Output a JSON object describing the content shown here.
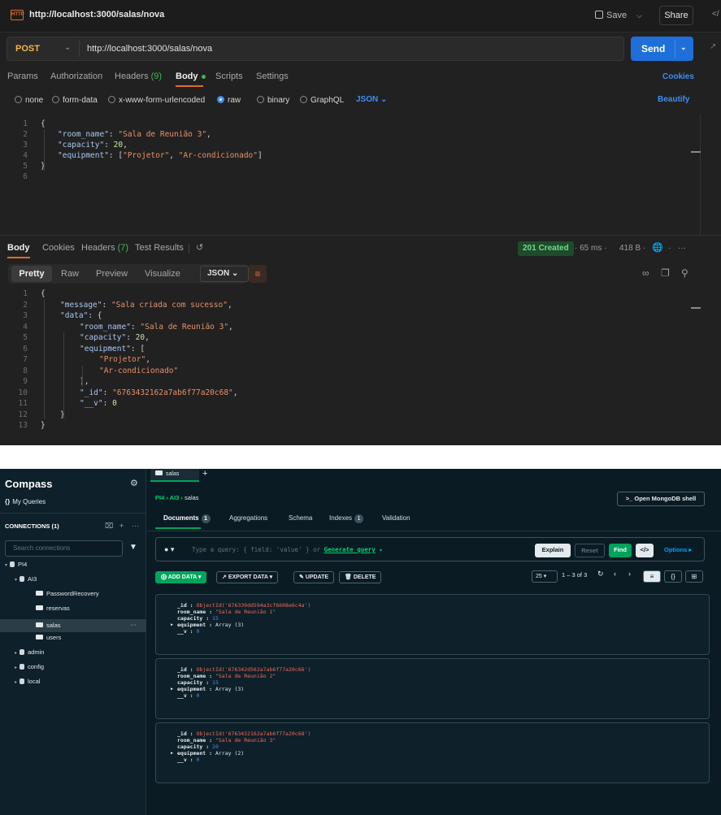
{
  "postman": {
    "window_title": "http://localhost:3000/salas/nova",
    "save_label": "Save",
    "share_label": "Share",
    "method": "POST",
    "url": "http://localhost:3000/salas/nova",
    "send_label": "Send",
    "req_tabs": {
      "params": "Params",
      "authorization": "Authorization",
      "headers": "Headers",
      "headers_count": "(9)",
      "body": "Body",
      "scripts": "Scripts",
      "settings": "Settings"
    },
    "cookies_label": "Cookies",
    "body_types": [
      "none",
      "form-data",
      "x-www-form-urlencoded",
      "raw",
      "binary",
      "GraphQL"
    ],
    "raw_format": "JSON",
    "beautify_label": "Beautify",
    "request_lines": [
      {
        "n": "1",
        "indent": 0,
        "parts": [
          [
            "p",
            "{"
          ]
        ]
      },
      {
        "n": "2",
        "indent": 1,
        "parts": [
          [
            "k",
            "\"room_name\""
          ],
          [
            "p",
            ": "
          ],
          [
            "s",
            "\"Sala de Reunião 3\""
          ],
          [
            "p",
            ","
          ]
        ]
      },
      {
        "n": "3",
        "indent": 1,
        "parts": [
          [
            "k",
            "\"capacity\""
          ],
          [
            "p",
            ": "
          ],
          [
            "n",
            "20"
          ],
          [
            "p",
            ","
          ]
        ]
      },
      {
        "n": "4",
        "indent": 1,
        "parts": [
          [
            "k",
            "\"equipment\""
          ],
          [
            "p",
            ": ["
          ],
          [
            "s",
            "\"Projetor\""
          ],
          [
            "p",
            ", "
          ],
          [
            "s",
            "\"Ar-condicionado\""
          ],
          [
            "p",
            "]"
          ]
        ]
      },
      {
        "n": "5",
        "indent": 0,
        "parts": [
          [
            "p",
            "}"
          ]
        ]
      },
      {
        "n": "6",
        "indent": 0,
        "parts": []
      }
    ],
    "resp_tabs": {
      "body": "Body",
      "cookies": "Cookies",
      "headers": "Headers",
      "headers_count": "(7)",
      "test_results": "Test Results"
    },
    "status": "201 Created",
    "time": "65 ms",
    "size": "418 B",
    "resp_formats": [
      "Pretty",
      "Raw",
      "Preview",
      "Visualize"
    ],
    "resp_format_sel": "JSON",
    "response_lines": [
      {
        "n": "1",
        "indent": 0,
        "parts": [
          [
            "p",
            "{"
          ]
        ]
      },
      {
        "n": "2",
        "indent": 1,
        "parts": [
          [
            "k",
            "\"message\""
          ],
          [
            "p",
            ": "
          ],
          [
            "s",
            "\"Sala criada com sucesso\""
          ],
          [
            "p",
            ","
          ]
        ]
      },
      {
        "n": "3",
        "indent": 1,
        "parts": [
          [
            "k",
            "\"data\""
          ],
          [
            "p",
            ": {"
          ]
        ]
      },
      {
        "n": "4",
        "indent": 2,
        "parts": [
          [
            "k",
            "\"room_name\""
          ],
          [
            "p",
            ": "
          ],
          [
            "s",
            "\"Sala de Reunião 3\""
          ],
          [
            "p",
            ","
          ]
        ]
      },
      {
        "n": "5",
        "indent": 2,
        "parts": [
          [
            "k",
            "\"capacity\""
          ],
          [
            "p",
            ": "
          ],
          [
            "n",
            "20"
          ],
          [
            "p",
            ","
          ]
        ]
      },
      {
        "n": "6",
        "indent": 2,
        "parts": [
          [
            "k",
            "\"equipment\""
          ],
          [
            "p",
            ": ["
          ]
        ]
      },
      {
        "n": "7",
        "indent": 3,
        "parts": [
          [
            "s",
            "\"Projetor\""
          ],
          [
            "p",
            ","
          ]
        ]
      },
      {
        "n": "8",
        "indent": 3,
        "parts": [
          [
            "s",
            "\"Ar-condicionado\""
          ]
        ]
      },
      {
        "n": "9",
        "indent": 2,
        "parts": [
          [
            "p",
            "],"
          ]
        ]
      },
      {
        "n": "10",
        "indent": 2,
        "parts": [
          [
            "k",
            "\"_id\""
          ],
          [
            "p",
            ": "
          ],
          [
            "s",
            "\"6763432162a7ab6f77a20c68\""
          ],
          [
            "p",
            ","
          ]
        ]
      },
      {
        "n": "11",
        "indent": 2,
        "parts": [
          [
            "k",
            "\"__v\""
          ],
          [
            "p",
            ": "
          ],
          [
            "n",
            "0"
          ]
        ]
      },
      {
        "n": "12",
        "indent": 1,
        "parts": [
          [
            "p",
            "}"
          ]
        ]
      },
      {
        "n": "13",
        "indent": 0,
        "parts": [
          [
            "p",
            "}"
          ]
        ]
      }
    ]
  },
  "compass": {
    "brand": "Compass",
    "my_queries": "My Queries",
    "connections_label": "CONNECTIONS (1)",
    "search_placeholder": "Search connections",
    "tree": [
      {
        "level": 0,
        "type": "conn",
        "label": "PI4"
      },
      {
        "level": 1,
        "type": "db",
        "label": "AI3"
      },
      {
        "level": 2,
        "type": "col",
        "label": "PasswordRecovery"
      },
      {
        "level": 2,
        "type": "col",
        "label": "reservas"
      },
      {
        "level": 2,
        "type": "col",
        "label": "salas",
        "selected": true
      },
      {
        "level": 2,
        "type": "col",
        "label": "users"
      },
      {
        "level": 1,
        "type": "db",
        "label": "admin"
      },
      {
        "level": 1,
        "type": "db",
        "label": "config"
      },
      {
        "level": 1,
        "type": "db",
        "label": "local"
      }
    ],
    "tab_label": "salas",
    "breadcrumb": [
      "PI4",
      "AI3",
      "salas"
    ],
    "open_shell_label": "Open MongoDB shell",
    "subtabs": [
      {
        "label": "Documents",
        "badge": "1"
      },
      {
        "label": "Aggregations",
        "badge": ""
      },
      {
        "label": "Schema",
        "badge": ""
      },
      {
        "label": "Indexes",
        "badge": "1"
      },
      {
        "label": "Validation",
        "badge": ""
      }
    ],
    "query_placeholder": "Type a query: { field: 'value' } or",
    "generate_query": "Generate query",
    "explain_label": "Explain",
    "reset_label": "Reset",
    "find_label": "Find",
    "options_label": "Options",
    "add_data_label": "ADD DATA",
    "export_data_label": "EXPORT DATA",
    "update_label": "UPDATE",
    "delete_label": "DELETE",
    "page_size": "25",
    "page_range": "1 – 3 of 3",
    "documents": [
      {
        "_id": "ObjectId('676339dd594a3cf6608e6c4a')",
        "room_name": "\"Sala de Reunião 1\"",
        "capacity": "15",
        "equipment": "Array (3)",
        "__v": "0"
      },
      {
        "_id": "ObjectId('676342d562a7ab6f77a20c66')",
        "room_name": "\"Sala de Reunião 2\"",
        "capacity": "15",
        "equipment": "Array (3)",
        "__v": "0"
      },
      {
        "_id": "ObjectId('6763432162a7ab6f77a20c68')",
        "room_name": "\"Sala de Reunião 3\"",
        "capacity": "20",
        "equipment": "Array (2)",
        "__v": "0"
      }
    ]
  }
}
